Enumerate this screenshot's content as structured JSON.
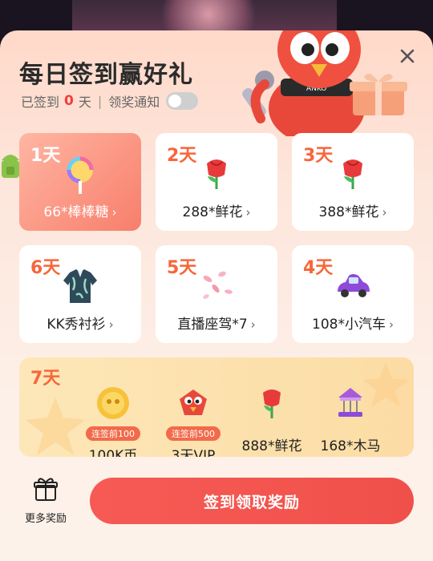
{
  "header": {
    "title": "每日签到赢好礼",
    "signed_prefix": "已签到",
    "signed_count": "0",
    "signed_suffix": "天",
    "notify_label": "领奖通知",
    "notify_on": false
  },
  "days": [
    {
      "day": "1天",
      "prize": "66*棒棒糖",
      "icon": "lollipop-icon",
      "active": true
    },
    {
      "day": "2天",
      "prize": "288*鲜花",
      "icon": "rose-icon",
      "active": false
    },
    {
      "day": "3天",
      "prize": "388*鲜花",
      "icon": "rose-icon",
      "active": false
    },
    {
      "day": "6天",
      "prize": "KK秀衬衫",
      "icon": "shirt-icon",
      "active": false
    },
    {
      "day": "5天",
      "prize": "直播座驾*7",
      "icon": "petals-icon",
      "active": false
    },
    {
      "day": "4天",
      "prize": "108*小汽车",
      "icon": "car-icon",
      "active": false
    }
  ],
  "day7": {
    "day": "7天",
    "items": [
      {
        "tag": "连签前100",
        "label": "100K币",
        "icon": "coin-icon"
      },
      {
        "tag": "连签前500",
        "label": "3天VIP",
        "icon": "vip-bird-icon"
      },
      {
        "tag": "",
        "label": "888*鲜花",
        "icon": "rose-icon"
      },
      {
        "tag": "",
        "label": "168*木马",
        "icon": "carousel-icon"
      }
    ]
  },
  "footer": {
    "more_label": "更多奖励",
    "cta_label": "签到领取奖励"
  },
  "colors": {
    "accent": "#f75a55",
    "day_label": "#f7663a",
    "highlight": "#f23d3d"
  }
}
